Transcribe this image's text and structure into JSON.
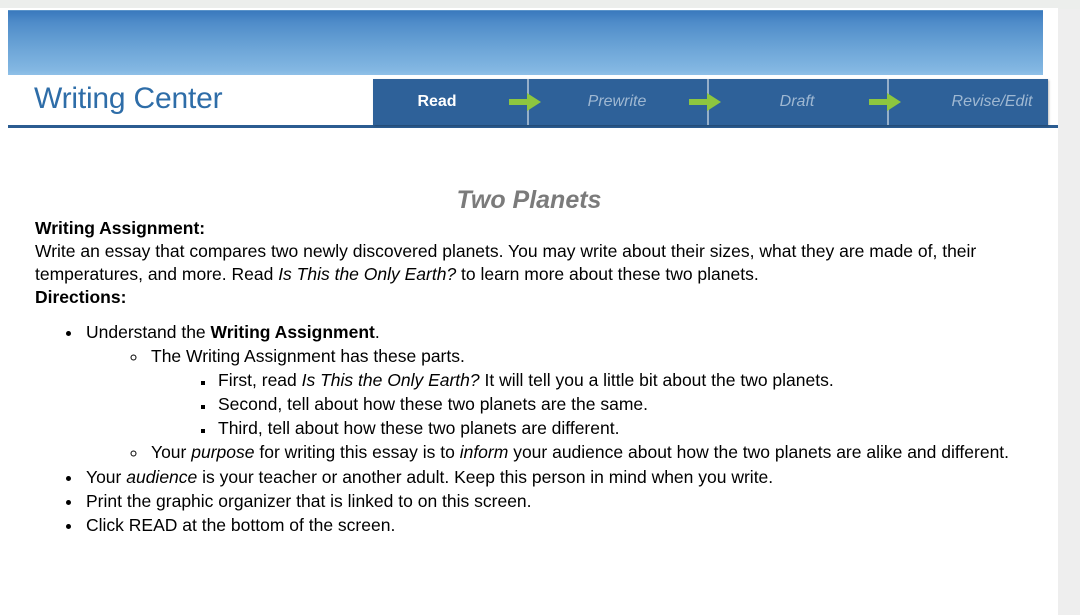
{
  "banner": {
    "gradient_top": "#3a79bd",
    "gradient_bottom": "#8fc0e8"
  },
  "masthead": {
    "brand": "Writing Center",
    "brand_color": "#2e6da8",
    "rule_color": "#2b5c91"
  },
  "nav": {
    "background": "#2e6199",
    "arrow_color": "#8dc63f",
    "active_color": "#ffffff",
    "inactive_color": "#9fb8d2",
    "steps": [
      {
        "label": "Read",
        "state": "active"
      },
      {
        "label": "Prewrite",
        "state": "inactive"
      },
      {
        "label": "Draft",
        "state": "inactive"
      },
      {
        "label": "Revise/Edit",
        "state": "inactive"
      }
    ],
    "separator_icon": "arrow-right-icon"
  },
  "document": {
    "title": "Two Planets",
    "title_color": "#7b7b7b",
    "assignment_heading": "Writing Assignment:",
    "assignment_body_1": "Write an essay that compares two newly discovered planets. You may write about their sizes, what they are made of, their temperatures, and more. Read ",
    "assignment_body_italic": "Is This the Only Earth?",
    "assignment_body_2": " to learn more about these two planets.",
    "directions_heading": "Directions:",
    "bullets": {
      "understand_prefix": "Understand the ",
      "understand_bold": "Writing Assignment",
      "understand_suffix": ".",
      "parts_intro": "The Writing Assignment has these parts.",
      "part_first_prefix": "First, read ",
      "part_first_italic": "Is This the Only Earth?",
      "part_first_suffix": " It will tell you a little bit about the two planets.",
      "part_second": "Second, tell about how these two planets are the same.",
      "part_third": "Third, tell about how these two planets are different.",
      "purpose_p1": "Your ",
      "purpose_italic_1": "purpose",
      "purpose_p2": " for writing this essay is to ",
      "purpose_italic_2": "inform",
      "purpose_p3": " your audience about how the two planets are alike and different.",
      "audience_p1": "Your ",
      "audience_italic": "audience",
      "audience_p2": " is your teacher or another adult. Keep this person in mind when you write.",
      "print_organizer": "Print the graphic organizer that is linked to on this screen.",
      "click_read": "Click READ at the bottom of the screen."
    }
  }
}
